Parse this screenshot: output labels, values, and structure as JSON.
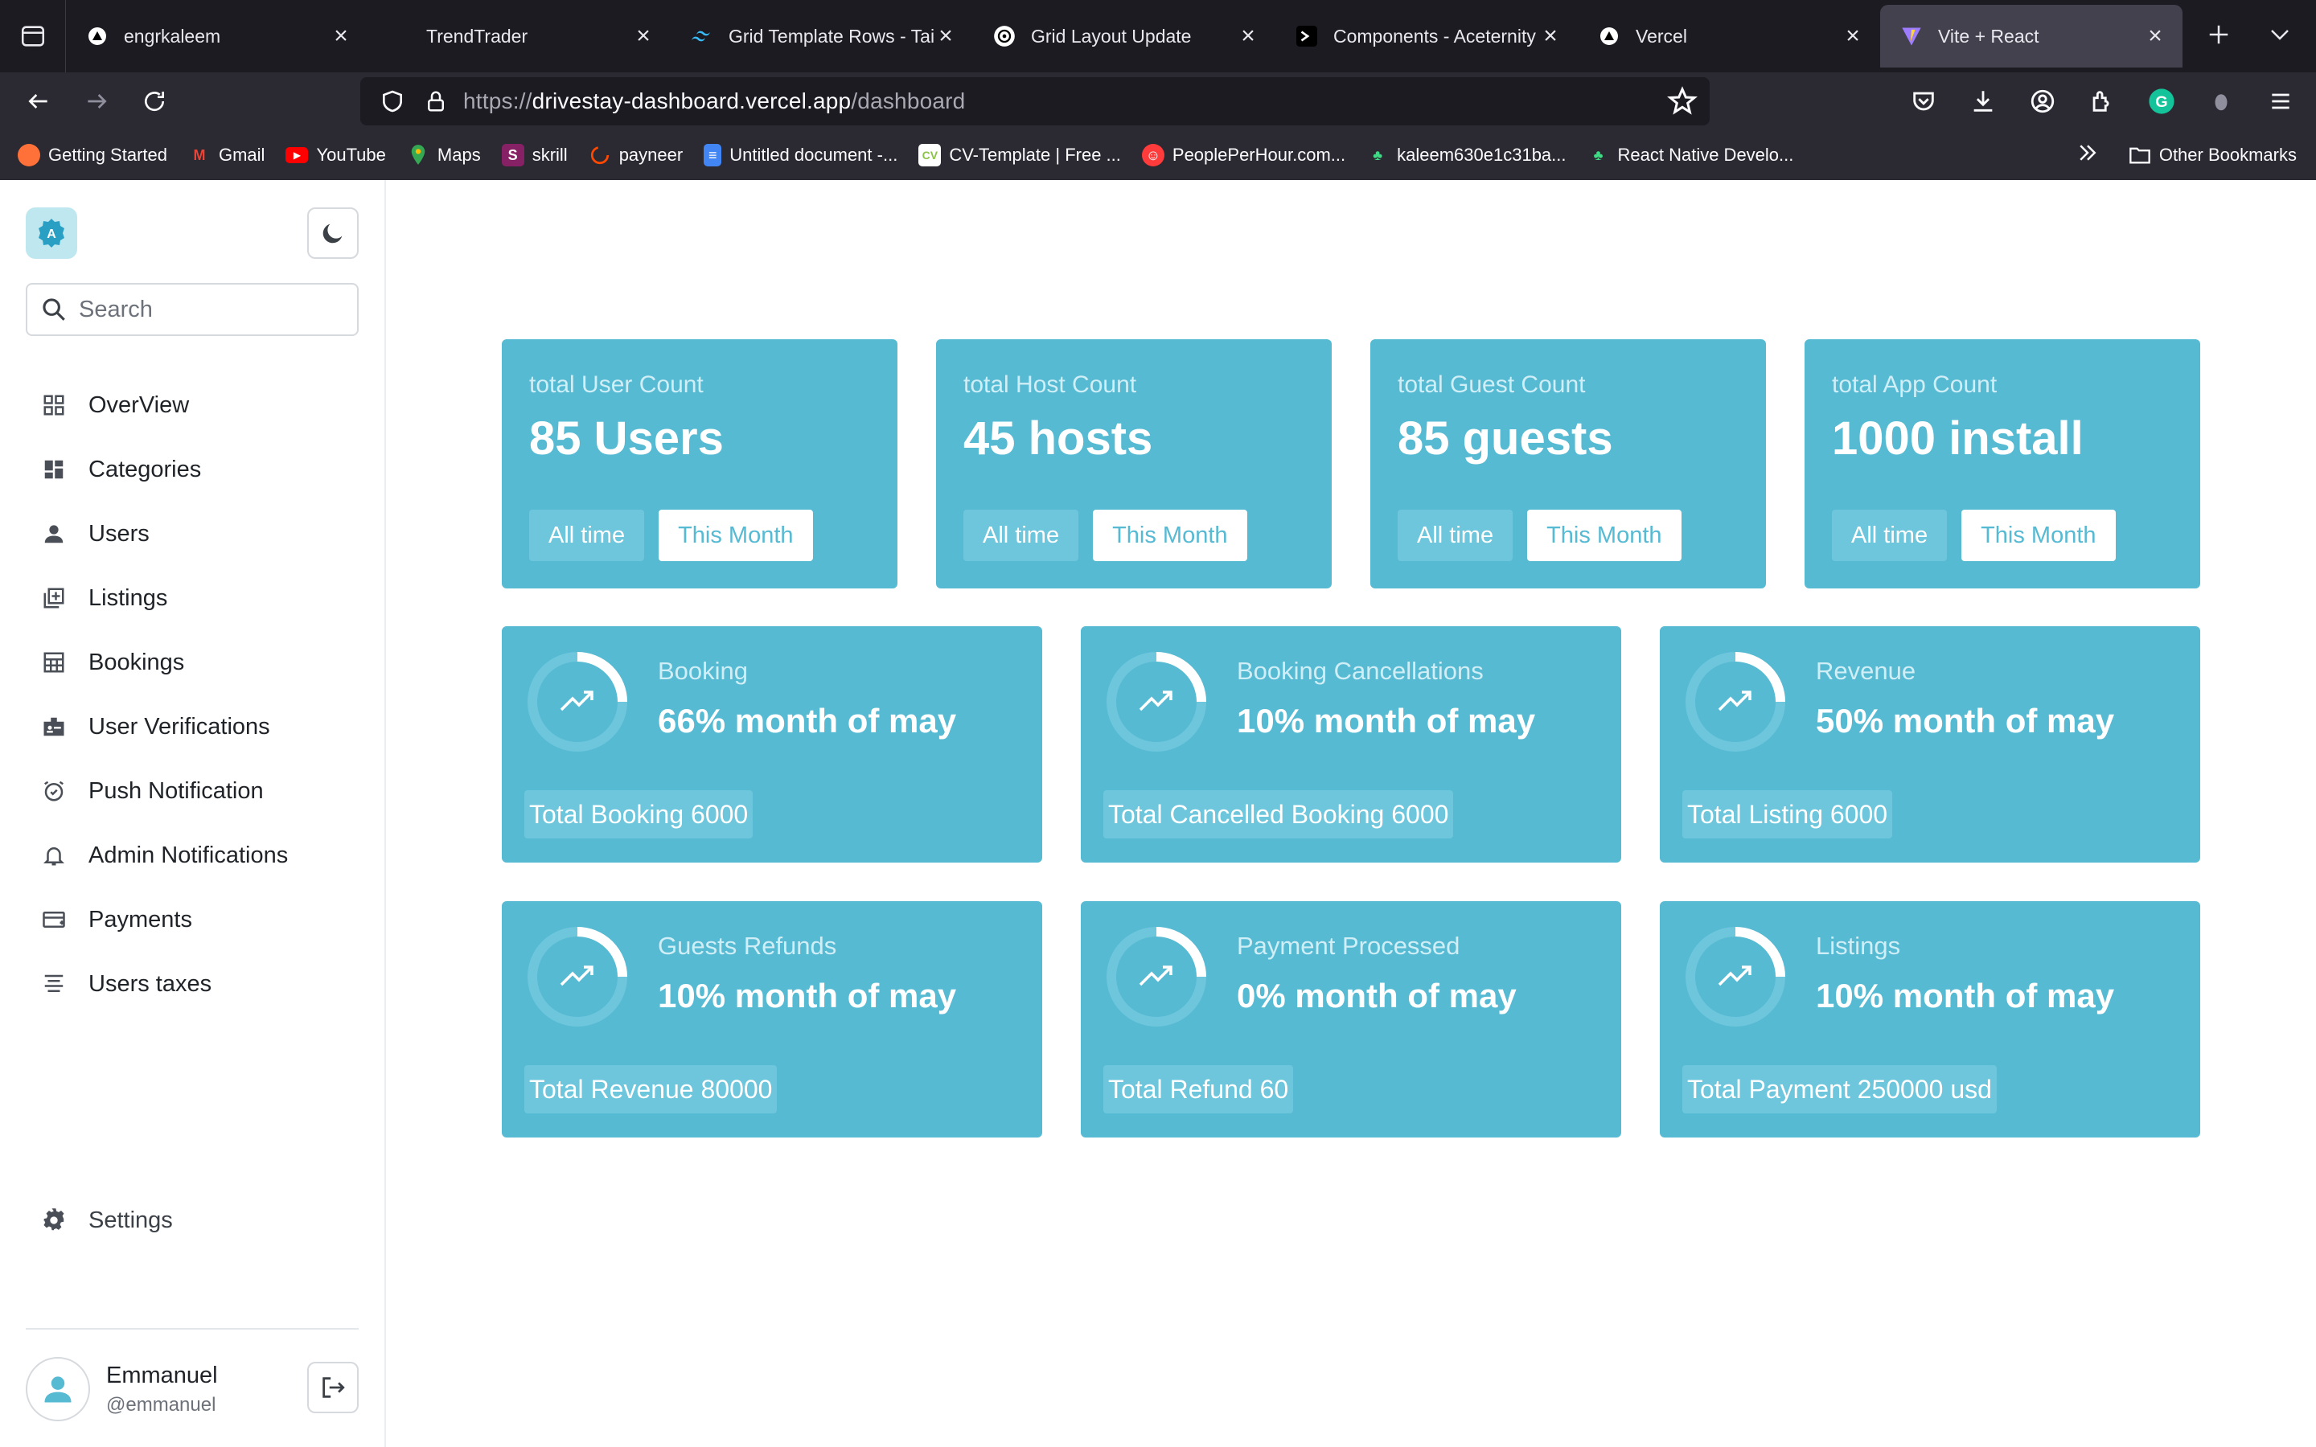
{
  "browser": {
    "tabs": [
      {
        "title": "engrkaleem",
        "favicon": "triangle-icon",
        "active": false
      },
      {
        "title": "TrendTrader",
        "favicon": "",
        "active": false
      },
      {
        "title": "Grid Template Rows - Tai",
        "favicon": "tailwind-icon",
        "active": false
      },
      {
        "title": "Grid Layout Update",
        "favicon": "openai-icon",
        "active": false
      },
      {
        "title": "Components - Aceternity",
        "favicon": "aceternity-icon",
        "active": false
      },
      {
        "title": "Vercel",
        "favicon": "triangle-icon",
        "active": false
      },
      {
        "title": "Vite + React",
        "favicon": "vite-icon",
        "active": true
      }
    ],
    "url_scheme": "https://",
    "url_host": "drivestay-dashboard.vercel.app",
    "url_path": "/dashboard",
    "bookmarks": [
      {
        "label": "Getting Started",
        "icon": "firefox-icon",
        "color": "#ff7139"
      },
      {
        "label": "Gmail",
        "icon": "gmail-icon",
        "color": "#ea4335"
      },
      {
        "label": "YouTube",
        "icon": "youtube-icon",
        "color": "#ff0000"
      },
      {
        "label": "Maps",
        "icon": "maps-icon",
        "color": "#34a853"
      },
      {
        "label": "skrill",
        "icon": "skrill-icon",
        "color": "#862165"
      },
      {
        "label": "payneer",
        "icon": "payoneer-icon",
        "color": "#ff4800"
      },
      {
        "label": "Untitled document -...",
        "icon": "docs-icon",
        "color": "#4285f4"
      },
      {
        "label": "CV-Template | Free ...",
        "icon": "cv-icon",
        "color": "#8bc34a"
      },
      {
        "label": "PeoplePerHour.com...",
        "icon": "pph-icon",
        "color": "#ff3b3b"
      },
      {
        "label": "kaleem630e1c31ba...",
        "icon": "sprout-icon",
        "color": "#3ddc84"
      },
      {
        "label": "React Native Develo...",
        "icon": "sprout-icon",
        "color": "#3ddc84"
      }
    ],
    "other_bookmarks": "Other Bookmarks"
  },
  "sidebar": {
    "logo_letter": "A",
    "search_placeholder": "Search",
    "items": [
      {
        "label": "OverView",
        "icon": "grid-icon"
      },
      {
        "label": "Categories",
        "icon": "dashboard-icon"
      },
      {
        "label": "Users",
        "icon": "person-icon"
      },
      {
        "label": "Listings",
        "icon": "add-box-icon"
      },
      {
        "label": "Bookings",
        "icon": "calendar-grid-icon"
      },
      {
        "label": "User Verifications",
        "icon": "badge-icon"
      },
      {
        "label": "Push Notification",
        "icon": "alarm-icon"
      },
      {
        "label": "Admin Notifications",
        "icon": "bell-icon"
      },
      {
        "label": "Payments",
        "icon": "card-icon"
      },
      {
        "label": "Users taxes",
        "icon": "lines-icon"
      }
    ],
    "settings_label": "Settings",
    "user": {
      "name": "Emmanuel",
      "handle": "@emmanuel"
    }
  },
  "stats": [
    {
      "label": "total User Count",
      "value": "85 Users",
      "all_time": "All time",
      "this_month": "This Month"
    },
    {
      "label": "total Host Count",
      "value": "45 hosts",
      "all_time": "All time",
      "this_month": "This Month"
    },
    {
      "label": "total Guest Count",
      "value": "85 guests",
      "all_time": "All time",
      "this_month": "This Month"
    },
    {
      "label": "total App Count",
      "value": "1000 install",
      "all_time": "All time",
      "this_month": "This Month"
    }
  ],
  "progress_cards": [
    {
      "label": "Booking",
      "value": "66% month of may",
      "total": "Total Booking 6000",
      "percent": 0.25
    },
    {
      "label": "Booking Cancellations",
      "value": "10% month of may",
      "total": "Total Cancelled Booking 6000",
      "percent": 0.25
    },
    {
      "label": "Revenue",
      "value": "50% month of may",
      "total": "Total Listing 6000",
      "percent": 0.25
    },
    {
      "label": "Guests Refunds",
      "value": "10% month of may",
      "total": "Total Revenue 80000",
      "percent": 0.25
    },
    {
      "label": "Payment Processed",
      "value": "0% month of may",
      "total": "Total Refund 60",
      "percent": 0.25
    },
    {
      "label": "Listings",
      "value": "10% month of may",
      "total": "Total Payment 250000 usd",
      "percent": 0.25
    }
  ],
  "colors": {
    "card": "#56bad3",
    "card_light": "#6dc6dc",
    "label": "#cfeef6",
    "chrome_dark": "#1c1b22",
    "chrome": "#2b2a33"
  }
}
